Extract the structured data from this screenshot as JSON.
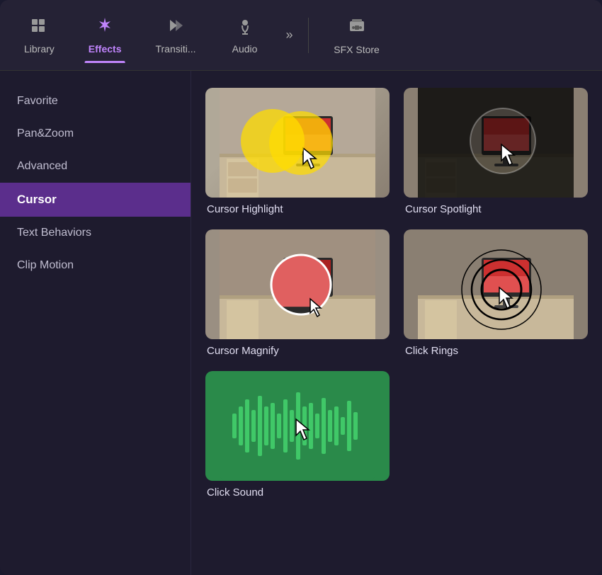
{
  "nav": {
    "items": [
      {
        "id": "library",
        "label": "Library",
        "icon": "🗂",
        "active": false
      },
      {
        "id": "effects",
        "label": "Effects",
        "icon": "✨",
        "active": true
      },
      {
        "id": "transitions",
        "label": "Transiti...",
        "icon": "⏭",
        "active": false
      },
      {
        "id": "audio",
        "label": "Audio",
        "icon": "♪",
        "active": false
      }
    ],
    "more_icon": "»",
    "sfx": {
      "label": "SFX Store",
      "icon": "🎪"
    }
  },
  "sidebar": {
    "items": [
      {
        "id": "favorite",
        "label": "Favorite",
        "active": false
      },
      {
        "id": "pan-zoom",
        "label": "Pan&Zoom",
        "active": false
      },
      {
        "id": "advanced",
        "label": "Advanced",
        "active": false
      },
      {
        "id": "cursor",
        "label": "Cursor",
        "active": true
      },
      {
        "id": "text-behaviors",
        "label": "Text Behaviors",
        "active": false
      },
      {
        "id": "clip-motion",
        "label": "Clip Motion",
        "active": false
      }
    ]
  },
  "effects": {
    "items": [
      {
        "id": "cursor-highlight",
        "label": "Cursor Highlight",
        "thumb_type": "cursor-highlight"
      },
      {
        "id": "cursor-spotlight",
        "label": "Cursor Spotlight",
        "thumb_type": "cursor-spotlight"
      },
      {
        "id": "cursor-magnify",
        "label": "Cursor Magnify",
        "thumb_type": "cursor-magnify"
      },
      {
        "id": "click-rings",
        "label": "Click Rings",
        "thumb_type": "click-rings"
      },
      {
        "id": "click-sound",
        "label": "Click Sound",
        "thumb_type": "click-sound"
      }
    ]
  },
  "colors": {
    "accent": "#c084fc",
    "active_sidebar": "#5b2e8c",
    "bg_dark": "#1e1b2e",
    "bg_nav": "#252235"
  }
}
